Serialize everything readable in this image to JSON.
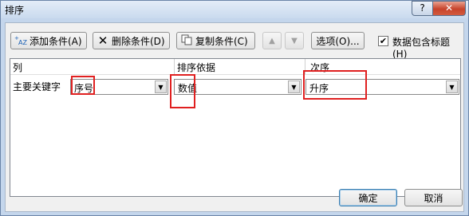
{
  "window": {
    "title": "排序",
    "help_label": "?",
    "close_label": "✕"
  },
  "toolbar": {
    "add": {
      "label": "添加条件(A)",
      "icon": "add-condition-icon"
    },
    "delete": {
      "label": "删除条件(D)",
      "icon": "delete-icon"
    },
    "copy": {
      "label": "复制条件(C)",
      "icon": "copy-icon"
    },
    "move_up": {
      "icon": "triangle-up-icon",
      "glyph": "▲"
    },
    "move_down": {
      "icon": "triangle-down-icon",
      "glyph": "▼"
    },
    "options": {
      "label": "选项(O)..."
    },
    "has_header": {
      "label": "数据包含标题(H)",
      "checked": true
    }
  },
  "columns": {
    "col1": "列",
    "col2": "排序依据",
    "col3": "次序"
  },
  "rows": [
    {
      "label": "主要关键字",
      "column": "序号",
      "sort_on": "数值",
      "order": "升序"
    }
  ],
  "footer": {
    "ok": "确定",
    "cancel": "取消"
  },
  "colors": {
    "highlight": "#e02020",
    "title_bar": "#c9daee",
    "close_button": "#c7432b"
  }
}
